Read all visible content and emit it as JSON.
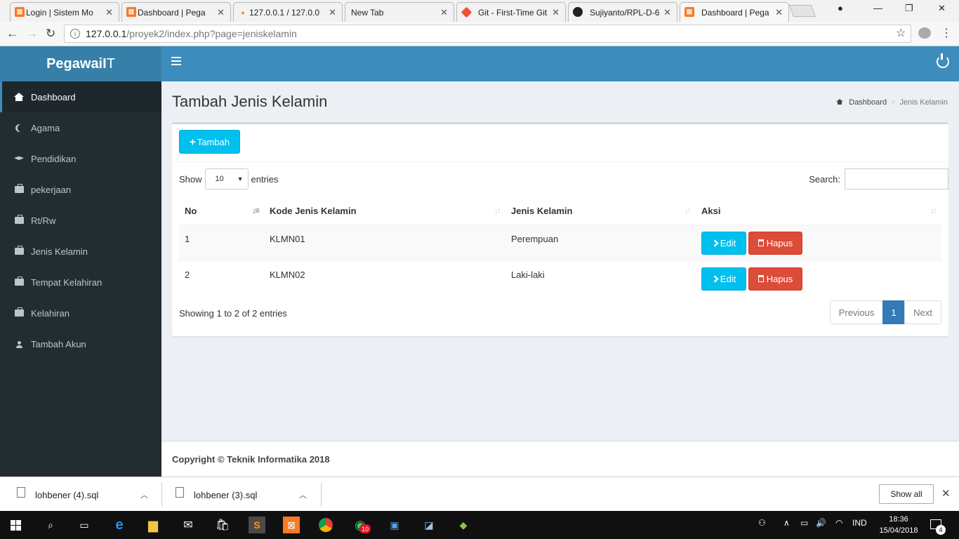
{
  "browser": {
    "tabs": [
      {
        "title": "Login | Sistem Mo",
        "favicon": "xampp-icon"
      },
      {
        "title": "Dashboard | Pega",
        "favicon": "xampp-icon"
      },
      {
        "title": "127.0.0.1 / 127.0.0",
        "favicon": "phpmyadmin-icon"
      },
      {
        "title": "New Tab",
        "favicon": ""
      },
      {
        "title": "Git - First-Time Git",
        "favicon": "git-icon"
      },
      {
        "title": "Sujiyanto/RPL-D-6",
        "favicon": "github-icon"
      },
      {
        "title": "Dashboard | Pega",
        "favicon": "xampp-icon",
        "active": true
      }
    ],
    "url_host": "127.0.0.1",
    "url_path": "/proyek2/index.php?page=jeniskelamin"
  },
  "app": {
    "brand_bold": "PegawaiI",
    "brand_light": "T",
    "accent": "#3c8dbc"
  },
  "sidebar": {
    "items": [
      {
        "label": "Dashboard",
        "icon": "home-icon",
        "active": true
      },
      {
        "label": "Agama",
        "icon": "moon-icon"
      },
      {
        "label": "Pendidikan",
        "icon": "graduation-cap-icon"
      },
      {
        "label": "pekerjaan",
        "icon": "briefcase-icon"
      },
      {
        "label": "Rt/Rw",
        "icon": "briefcase-icon"
      },
      {
        "label": "Jenis Kelamin",
        "icon": "briefcase-icon"
      },
      {
        "label": "Tempat Kelahiran",
        "icon": "briefcase-icon"
      },
      {
        "label": "Kelahiran",
        "icon": "briefcase-icon"
      },
      {
        "label": "Tambah Akun",
        "icon": "user-icon"
      }
    ]
  },
  "page": {
    "title": "Tambah Jenis Kelamin",
    "breadcrumb": {
      "home": "Dashboard",
      "current": "Jenis Kelamin"
    }
  },
  "toolbar": {
    "add_label": "Tambah"
  },
  "datatable": {
    "show_label": "Show",
    "length_value": "10",
    "entries_label": "entries",
    "search_label": "Search:",
    "columns": [
      "No",
      "Kode Jenis Kelamin",
      "Jenis Kelamin",
      "Aksi"
    ],
    "rows": [
      {
        "no": "1",
        "kode": "KLMN01",
        "jenis": "Perempuan"
      },
      {
        "no": "2",
        "kode": "KLMN02",
        "jenis": "Laki-laki"
      }
    ],
    "edit_label": "Edit",
    "delete_label": "Hapus",
    "info": "Showing 1 to 2 of 2 entries",
    "pagination": {
      "prev": "Previous",
      "current": "1",
      "next": "Next"
    }
  },
  "footer": {
    "text": "Copyright © Teknik Informatika 2018"
  },
  "downloads": {
    "items": [
      "lohbener (4).sql",
      "lohbener (3).sql"
    ],
    "show_all": "Show all"
  },
  "taskbar": {
    "time": "18:36",
    "date": "15/04/2018",
    "lang": "IND",
    "whatsapp_badge": "10",
    "notification_count": "4"
  }
}
